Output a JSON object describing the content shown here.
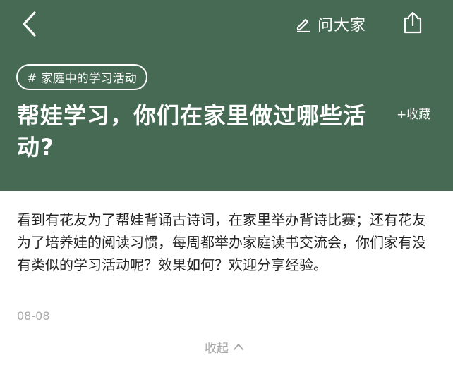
{
  "header": {
    "background_color": "#466a54",
    "back_icon": "chevron-left-icon",
    "ask": {
      "icon": "pencil-icon",
      "label": "问大家"
    },
    "share_icon": "share-icon"
  },
  "topic": {
    "label": "# 家庭中的学习活动"
  },
  "question": {
    "title": "帮娃学习，你们在家里做过哪些活动?",
    "collect_label": "+收藏",
    "body": "看到有花友为了帮娃背诵古诗词，在家里举办背诗比赛；还有花友为了培养娃的阅读习惯，每周都举办家庭读书交流会，你们家有没有类似的学习活动呢？效果如何？欢迎分享经验。",
    "date": "08-08",
    "collapse_label": "收起",
    "collapse_icon": "chevron-up-icon"
  }
}
